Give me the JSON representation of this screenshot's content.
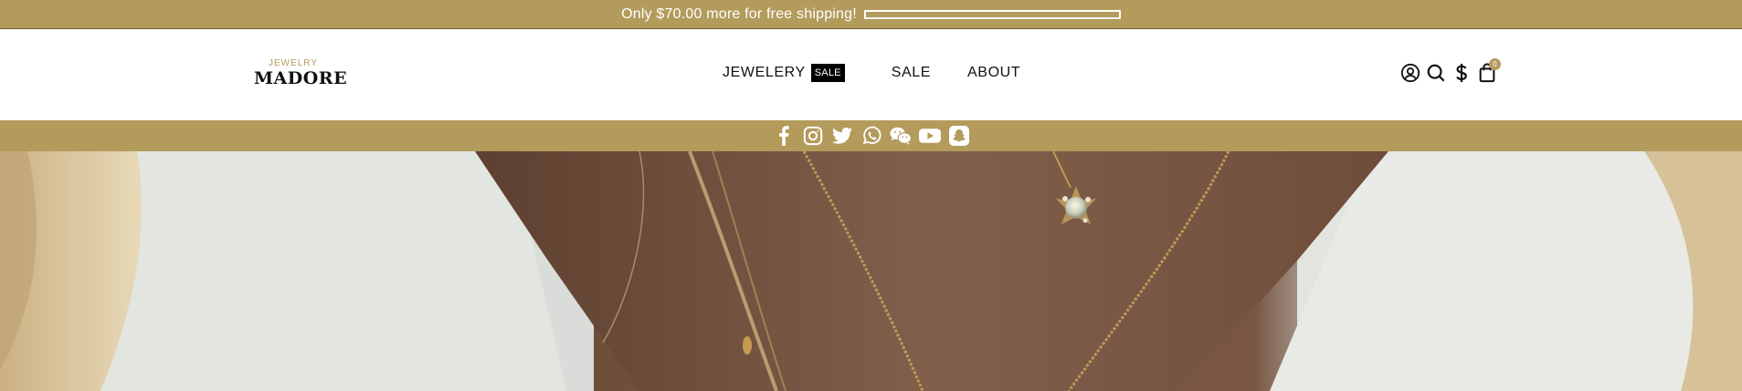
{
  "promo": {
    "shipping_text": "Only $70.00 more for free shipping!",
    "shipping_progress": 0.0
  },
  "logo": {
    "top": "JEWELRY",
    "main": "MADORE"
  },
  "nav": {
    "items": [
      {
        "label": "JEWELERY",
        "badge": "SALE"
      },
      {
        "label": "SALE"
      },
      {
        "label": "ABOUT"
      }
    ]
  },
  "header_icons": [
    "account-icon",
    "search-icon",
    "currency-icon",
    "cart-icon"
  ],
  "cart": {
    "count": "0"
  },
  "social": [
    "facebook-icon",
    "instagram-icon",
    "twitter-icon",
    "whatsapp-icon",
    "wechat-icon",
    "youtube-icon",
    "snapchat-icon"
  ],
  "colors": {
    "accent": "#b39b5c",
    "text": "#111111",
    "badge_bg": "#000000"
  }
}
